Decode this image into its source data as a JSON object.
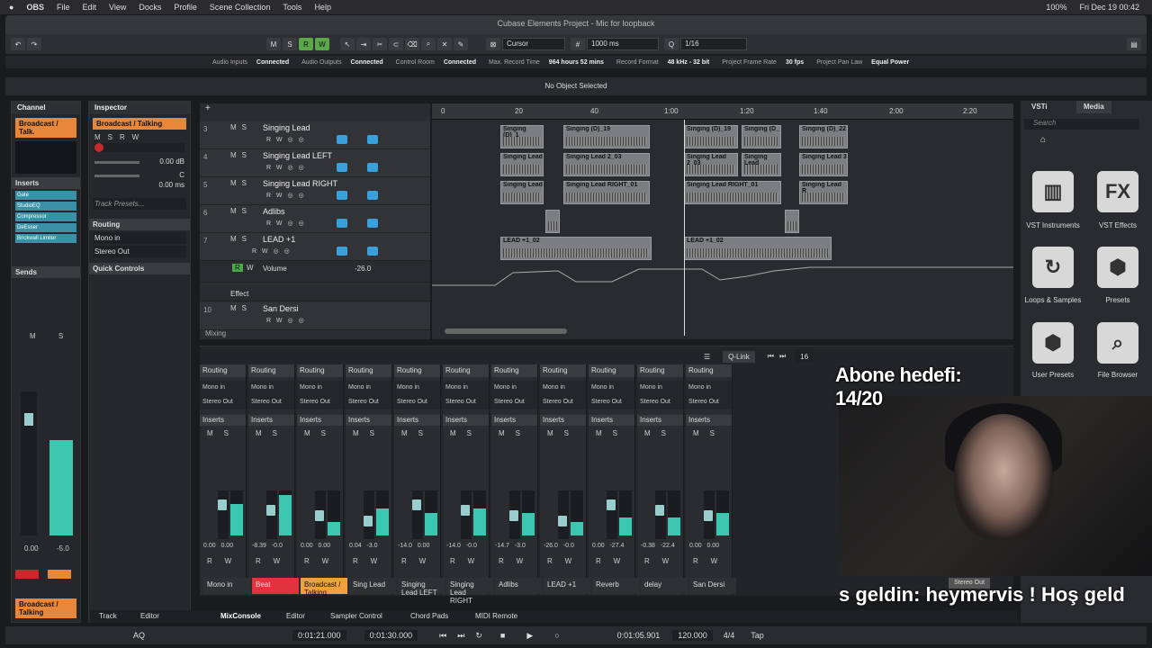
{
  "menubar": {
    "app": "OBS",
    "items": [
      "File",
      "Edit",
      "View",
      "Docks",
      "Profile",
      "Scene Collection",
      "Tools",
      "Help"
    ],
    "battery": "100%",
    "datetime": "Fri Dec 19  00:42"
  },
  "window": {
    "title": "Cubase Elements Project - Mic for loopback"
  },
  "toolbar": {
    "buttons": [
      "M",
      "S",
      "R",
      "W"
    ],
    "snap_mode": "Cursor",
    "grid": "1000 ms",
    "quantize": "1/16"
  },
  "statusbar": {
    "audio_inputs_label": "Audio Inputs",
    "audio_inputs": "Connected",
    "audio_outputs_label": "Audio Outputs",
    "audio_outputs": "Connected",
    "control_room_label": "Control Room",
    "control_room": "Connected",
    "max_rec_label": "Max. Record Time",
    "max_rec": "964 hours 52 mins",
    "rec_format_label": "Record Format",
    "rec_format": "48 kHz - 32 bit",
    "frame_rate_label": "Project Frame Rate",
    "frame_rate": "30 fps",
    "pan_law_label": "Project Pan Law",
    "pan_law": "Equal Power"
  },
  "info_line": "No Object Selected",
  "channel": {
    "title": "Channel",
    "name": "Broadcast / Talk.",
    "inserts_label": "Inserts",
    "inserts": [
      "Gate",
      "StudioEQ",
      "Compressor",
      "DeEsser",
      "Brickwall Limiter"
    ],
    "sends_label": "Sends",
    "values": [
      "0.00",
      "-5.0"
    ],
    "bottom_name": "Broadcast / Talking"
  },
  "inspector": {
    "title": "Inspector",
    "name": "Broadcast / Talking",
    "volume": "0.00 dB",
    "pan": "C",
    "delay": "0.00 ms",
    "track_presets": "Track Presets...",
    "routing_label": "Routing",
    "route_in": "Mono in",
    "route_out": "Stereo Out",
    "quick_controls": "Quick Controls"
  },
  "tracks": [
    {
      "num": "3",
      "name": "Singing Lead"
    },
    {
      "num": "4",
      "name": "Singing Lead LEFT"
    },
    {
      "num": "5",
      "name": "Singing Lead RIGHT"
    },
    {
      "num": "6",
      "name": "Adlibs"
    },
    {
      "num": "7",
      "name": "LEAD +1"
    },
    {
      "num": "",
      "name": "Volume"
    },
    {
      "num": "",
      "name": "Effect"
    },
    {
      "num": "10",
      "name": "San Dersi"
    }
  ],
  "automation_value": "-26.0",
  "tracklist_footer": "Mixing",
  "ruler": [
    "0",
    "20",
    "40",
    "1:00",
    "1:20",
    "1:40",
    "2:00",
    "2:20"
  ],
  "events": [
    "Singing (D)_1",
    "Singing (D)_19",
    "Singing (D)_19",
    "Singing (D_",
    "Singing (D)_22",
    "Singing Lead",
    "Singing Lead 2_03",
    "Singing Lead 2_03",
    "Singing Lead",
    "Singing Lead 3",
    "Singing Lead",
    "Singing Lead RIGHT_01",
    "Singing Lead RIGHT_01",
    "Singing Lead R",
    "LEAD +1_02",
    "LEAD +1_02"
  ],
  "media": {
    "tab1": "VSTi",
    "tab2": "Media",
    "search": "Search",
    "items": [
      {
        "label": "VST Instruments",
        "glyph": "▥"
      },
      {
        "label": "VST Effects",
        "glyph": "FX"
      },
      {
        "label": "Loops & Samples",
        "glyph": "↻"
      },
      {
        "label": "Presets",
        "glyph": "⬢"
      },
      {
        "label": "User Presets",
        "glyph": "⬢"
      },
      {
        "label": "File Browser",
        "glyph": "⌕"
      }
    ]
  },
  "mixer": {
    "qlink": "Q-Link",
    "count": "16",
    "routing": "Routing",
    "inserts": "Inserts",
    "mono_in": "Mono in",
    "stereo_out": "Stereo Out",
    "strips": [
      {
        "num": "1",
        "name": "Mono in",
        "v1": "0.00",
        "v2": "0.00"
      },
      {
        "num": "1",
        "name": "Beat",
        "v1": "-8.39",
        "v2": "-0.0"
      },
      {
        "num": "2",
        "name": "Broadcast / Talking",
        "v1": "0.00",
        "v2": "0.00"
      },
      {
        "num": "3",
        "name": "Sing Lead",
        "v1": "0.04",
        "v2": "-3.0"
      },
      {
        "num": "4",
        "name": "Singing Lead LEFT",
        "v1": "-14.0",
        "v2": "0.00"
      },
      {
        "num": "5",
        "name": "Singing Lead RIGHT",
        "v1": "-14.0",
        "v2": "-0.0"
      },
      {
        "num": "6",
        "name": "Adlibs",
        "v1": "-14.7",
        "v2": "-3.0"
      },
      {
        "num": "7",
        "name": "LEAD +1",
        "v1": "-26.0",
        "v2": "-0.0"
      },
      {
        "num": "8",
        "name": "Reverb",
        "v1": "0.00",
        "v2": "-27.4"
      },
      {
        "num": "9",
        "name": "delay",
        "v1": "-0.38",
        "v2": "-22.4"
      },
      {
        "num": "10",
        "name": "San Dersi",
        "v1": "0.00",
        "v2": "0.00"
      }
    ]
  },
  "bottom_tabs": [
    "Track",
    "Editor",
    "MixConsole",
    "Editor",
    "Sampler Control",
    "Chord Pads",
    "MIDI Remote"
  ],
  "transport": {
    "pos1": "0:01:21.000",
    "pos2": "0:01:30.000",
    "time": "0:01:05.901",
    "tempo": "120.000",
    "sig": "4/4",
    "tap": "Tap",
    "aq": "AQ"
  },
  "overlay": {
    "goal": "Abone hedefi: 14/20",
    "ticker": "s geldin: heymervis !   Hoş geld",
    "stereo_out": "Stereo Out"
  }
}
